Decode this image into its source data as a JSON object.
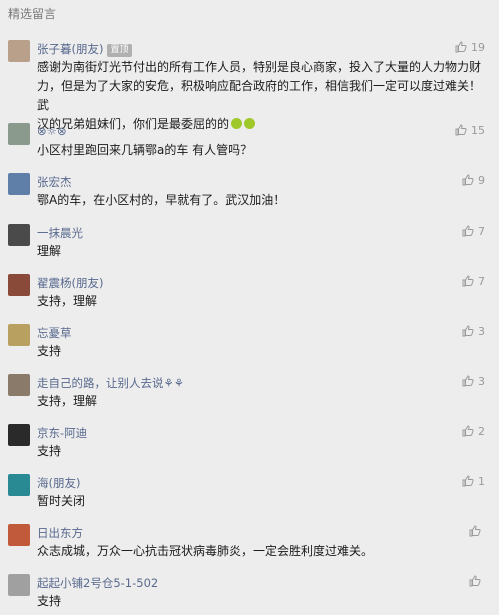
{
  "header": {
    "title": "精选留言"
  },
  "comments": [
    {
      "name": "张子暮(朋友)",
      "badge": "置顶",
      "likes": "19",
      "lines": [
        "感谢为南街灯光节付出的所有工作人员，特别是良心商家，投入了大量的人力物力财",
        "力，但是为了大家的安危，积极响应配合政府的工作，相信我们一定可以度过难关！武",
        "汉的兄弟姐妹们，你们是最委屈的的"
      ],
      "avatar_color": "#b9a08a"
    },
    {
      "name": "⊗☼⊗",
      "likes": "15",
      "lines": [
        "小区村里跑回来几辆鄂a的车  有人管吗？"
      ],
      "avatar_color": "#8a9a8c"
    },
    {
      "name": "张宏杰",
      "likes": "9",
      "lines": [
        "鄂A的车，在小区村的，早就有了。武汉加油！"
      ],
      "avatar_color": "#5f7fa8"
    },
    {
      "name": "一抹晨光",
      "likes": "7",
      "lines": [
        "理解"
      ],
      "avatar_color": "#4a4a4a"
    },
    {
      "name": "翟震杨(朋友)",
      "likes": "7",
      "lines": [
        "支持，理解"
      ],
      "avatar_color": "#8a4a3a"
    },
    {
      "name": "忘憂草",
      "likes": "3",
      "lines": [
        "支持"
      ],
      "avatar_color": "#b8a060"
    },
    {
      "name": "走自己的路，让别人去说⚘⚘",
      "likes": "3",
      "lines": [
        "支持，理解"
      ],
      "avatar_color": "#8a7a6a"
    },
    {
      "name": "京东-阿迪",
      "likes": "2",
      "lines": [
        "支持"
      ],
      "avatar_color": "#2a2a2a"
    },
    {
      "name": "海(朋友)",
      "likes": "1",
      "lines": [
        "暂时关闭"
      ],
      "avatar_color": "#2a8a94"
    },
    {
      "name": "日出东方",
      "likes": "",
      "lines": [
        "众志成城，万众一心抗击冠状病毒肺炎，一定会胜利度过难关。"
      ],
      "avatar_color": "#c05a3a"
    },
    {
      "name": "起起小铺2号仓5-1-502",
      "likes": "",
      "lines": [
        "支持"
      ],
      "avatar_color": "#a0a0a0"
    }
  ]
}
